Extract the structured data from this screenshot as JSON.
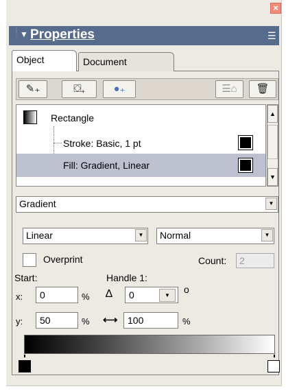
{
  "window": {
    "close_glyph": "×"
  },
  "header": {
    "title": "Properties",
    "collapse_glyph": "▼",
    "grip_glyph": "⁞",
    "options_glyph": "☰"
  },
  "tabs": [
    {
      "label": "Object",
      "active": true
    },
    {
      "label": "Document",
      "active": false
    }
  ],
  "toolbar": {
    "buttons": [
      {
        "icon": "add-stroke-icon",
        "glyph": "✎₊"
      },
      {
        "icon": "add-fill-icon",
        "glyph": "⛋₊"
      },
      {
        "icon": "add-effect-icon",
        "glyph": "●₊"
      },
      {
        "icon": "duplicate-icon",
        "glyph": "☰⌂"
      },
      {
        "icon": "delete-icon",
        "glyph": "🗑"
      }
    ]
  },
  "attributes": {
    "object": "Rectangle",
    "items": [
      {
        "label": "Stroke: Basic, 1 pt",
        "selected": false
      },
      {
        "label": "Fill: Gradient, Linear",
        "selected": true
      }
    ]
  },
  "scroll": {
    "up_glyph": "▲",
    "down_glyph": "▼"
  },
  "fill": {
    "type": "Gradient",
    "gradient_type": "Linear",
    "blend_mode": "Normal",
    "overprint_label": "Overprint",
    "overprint_checked": false,
    "count_label": "Count:",
    "count_value": "2"
  },
  "start": {
    "label": "Start:",
    "x_label": "x:",
    "x_value": "0",
    "y_label": "y:",
    "y_value": "50",
    "percent": "%"
  },
  "handle": {
    "label": "Handle 1:",
    "angle_value": "0",
    "degree_symbol": "o",
    "width_value": "100",
    "percent": "%",
    "angle_glyph": "∆",
    "width_glyph": "⟷"
  },
  "dropdown_glyph": "▼",
  "gradient_ramp": {
    "stops": [
      {
        "position": 0,
        "color": "#000000"
      },
      {
        "position": 1,
        "color": "#ffffff"
      }
    ]
  }
}
